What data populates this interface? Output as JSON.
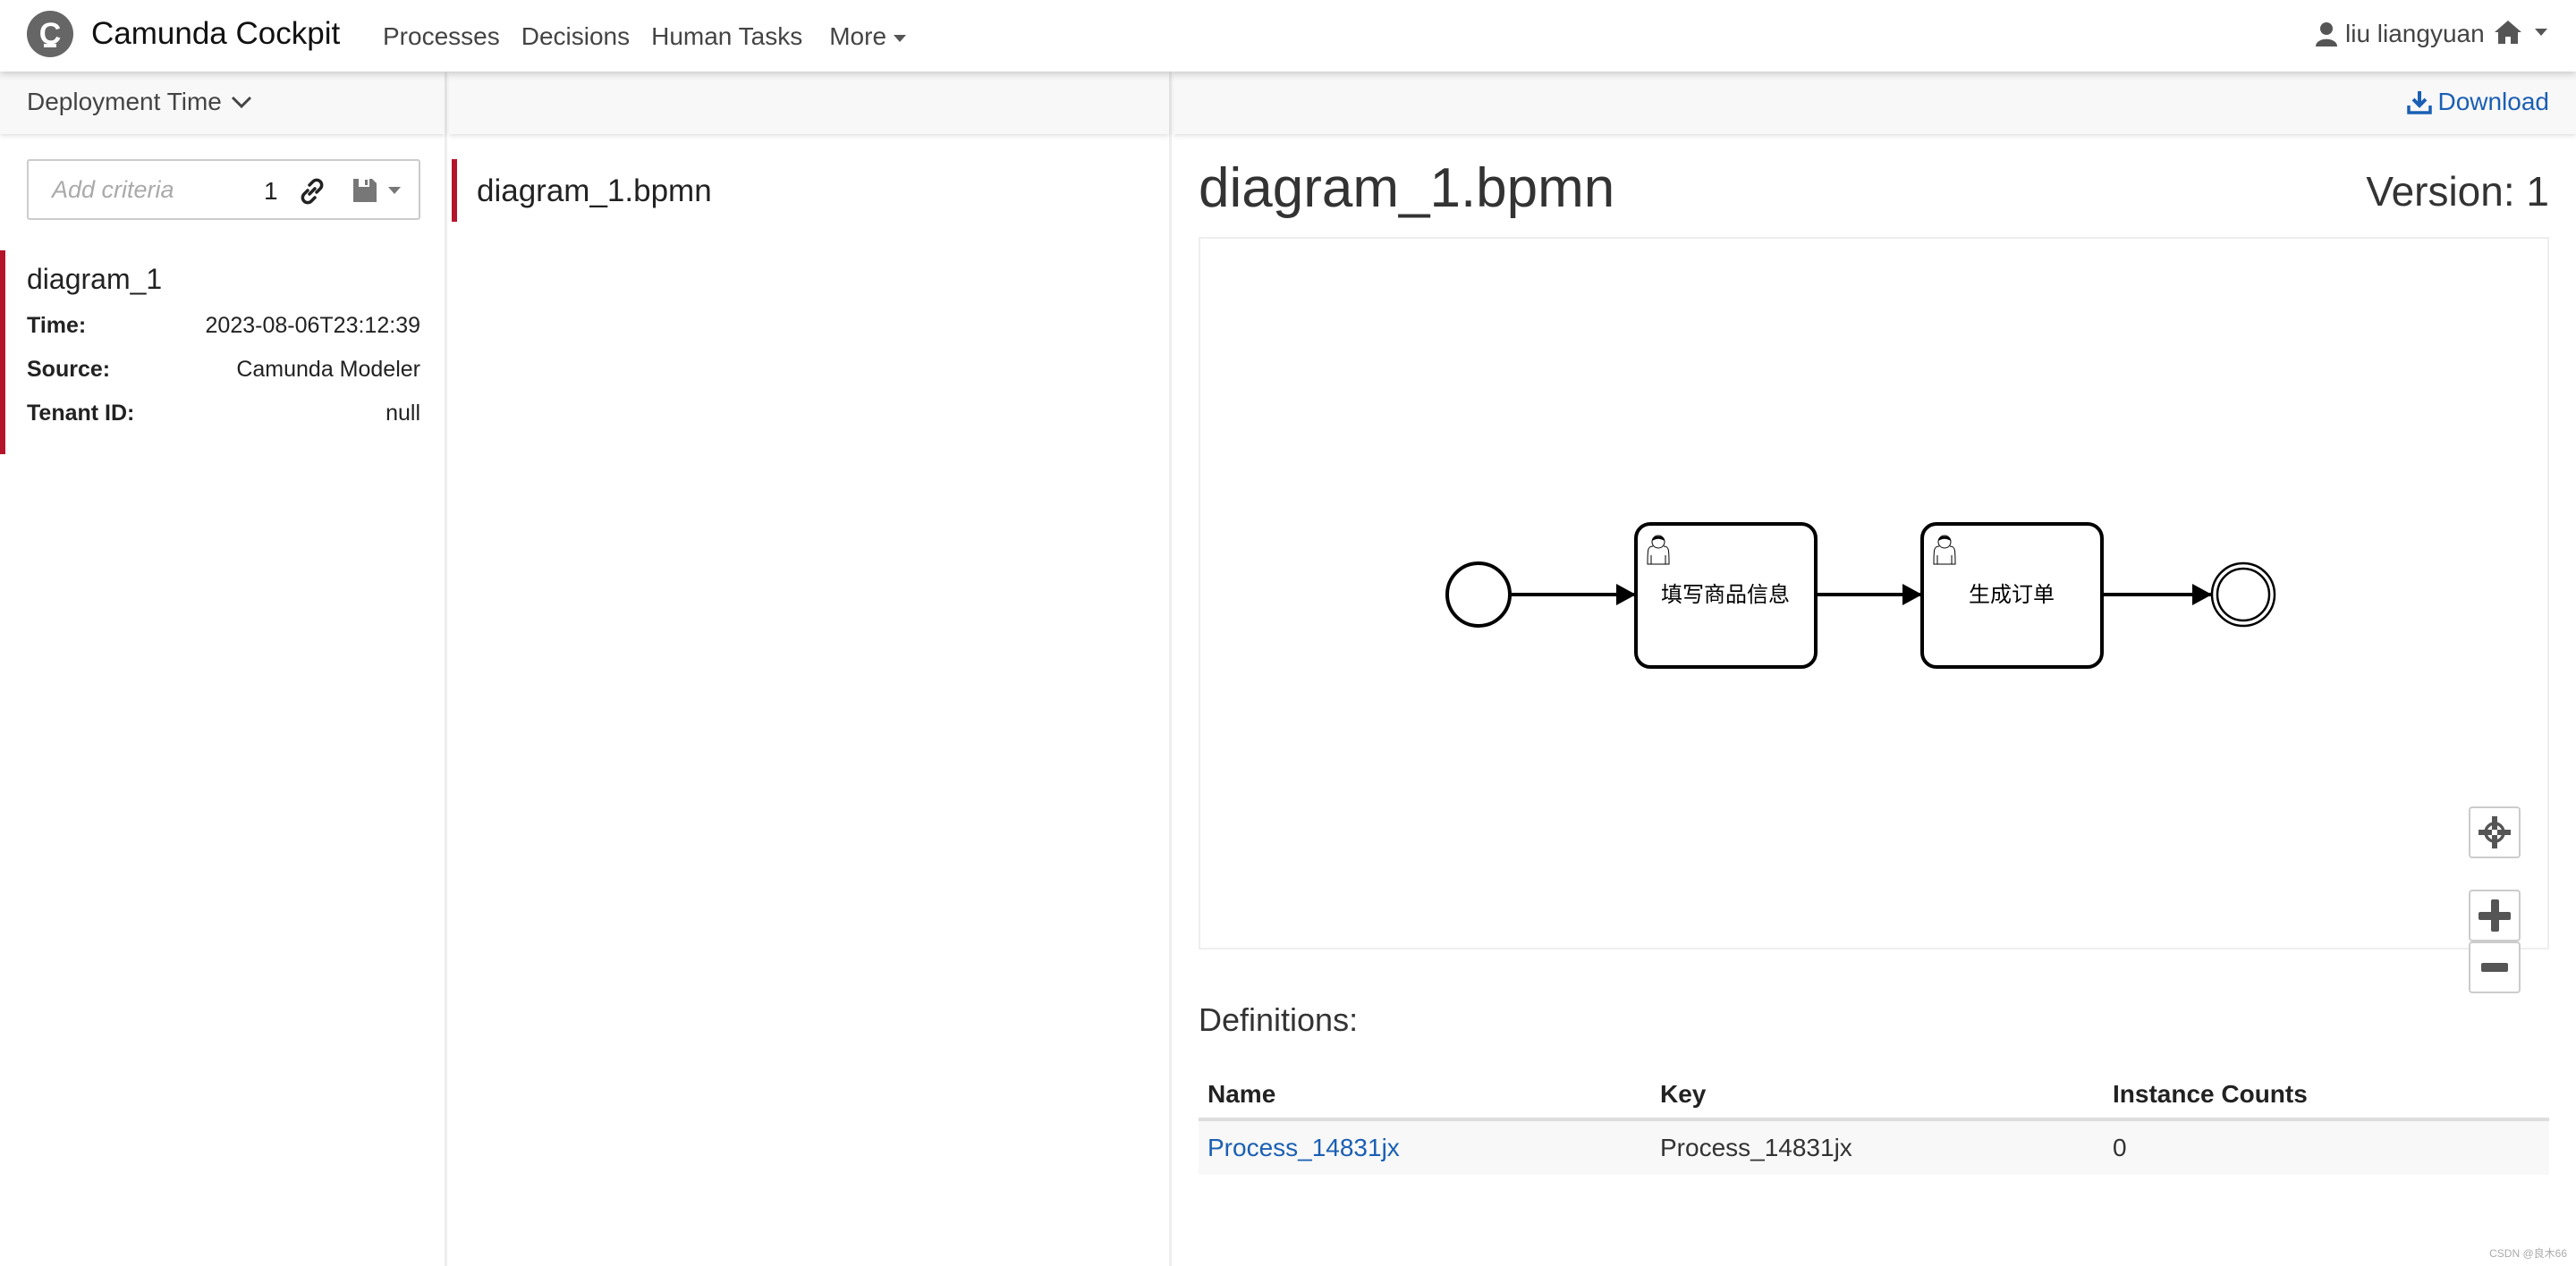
{
  "header": {
    "logo_letter": "C",
    "brand": "Camunda Cockpit",
    "nav": [
      {
        "label": "Processes"
      },
      {
        "label": "Decisions"
      },
      {
        "label": "Human Tasks"
      },
      {
        "label": "More"
      }
    ],
    "user": "liu liangyuan",
    "home_icon": "home-icon"
  },
  "left": {
    "sort_label": "Deployment Time",
    "filter": {
      "placeholder": "Add criteria",
      "count": "1"
    },
    "deployment": {
      "name": "diagram_1",
      "fields": [
        {
          "label": "Time:",
          "value": "2023-08-06T23:12:39"
        },
        {
          "label": "Source:",
          "value": "Camunda Modeler"
        },
        {
          "label": "Tenant ID:",
          "value": "null"
        }
      ]
    }
  },
  "middle": {
    "resources": [
      {
        "name": "diagram_1.bpmn"
      }
    ]
  },
  "right": {
    "download_label": "Download",
    "title": "diagram_1.bpmn",
    "version": "Version: 1",
    "diagram": {
      "tasks": [
        {
          "label": "填写商品信息",
          "type": "user-task"
        },
        {
          "label": "生成订单",
          "type": "user-task"
        }
      ]
    },
    "definitions_label": "Definitions:",
    "table": {
      "headers": [
        "Name",
        "Key",
        "Instance Counts"
      ],
      "rows": [
        {
          "name": "Process_14831jx",
          "key": "Process_14831jx",
          "count": "0"
        }
      ]
    }
  },
  "watermark": "CSDN @良木66",
  "colors": {
    "accent": "#b5152b",
    "link": "#1a5fb4"
  }
}
